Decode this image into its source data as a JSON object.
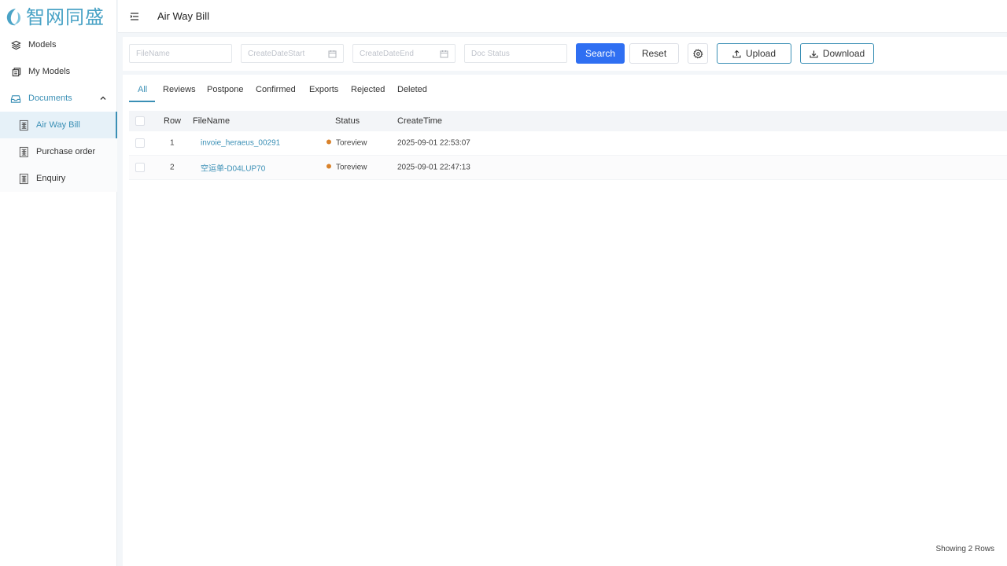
{
  "app": {
    "logo_text": "智网同盛"
  },
  "sidebar": {
    "items": [
      {
        "label": "Models",
        "icon": "layers-icon"
      },
      {
        "label": "My Models",
        "icon": "stack-icon"
      },
      {
        "label": "Documents",
        "icon": "inbox-icon",
        "expanded": true
      }
    ],
    "sub_items": [
      {
        "label": "Air Way Bill",
        "icon": "document-grid-icon",
        "active": true
      },
      {
        "label": "Purchase order",
        "icon": "document-grid-icon"
      },
      {
        "label": "Enquiry",
        "icon": "document-grid-icon"
      }
    ]
  },
  "header": {
    "title": "Air Way Bill"
  },
  "filters": {
    "file_name_placeholder": "FileName",
    "create_start_placeholder": "CreateDateStart",
    "create_end_placeholder": "CreateDateEnd",
    "doc_status_placeholder": "Doc Status",
    "search_label": "Search",
    "reset_label": "Reset",
    "upload_label": "Upload",
    "download_label": "Download"
  },
  "tabs": [
    "All",
    "Reviews",
    "Postpone",
    "Confirmed",
    "Exports",
    "Rejected",
    "Deleted"
  ],
  "active_tab": "All",
  "table": {
    "columns": [
      "Row",
      "FileName",
      "Status",
      "CreateTime"
    ],
    "rows": [
      {
        "row": "1",
        "file_name": "invoie_heraeus_00291",
        "status": "Toreview",
        "create_time": "2025-09-01 22:53:07"
      },
      {
        "row": "2",
        "file_name": "空运单-D04LUP70",
        "status": "Toreview",
        "create_time": "2025-09-01 22:47:13"
      }
    ]
  },
  "footer": {
    "rows_info": "Showing 2 Rows"
  },
  "colors": {
    "accent": "#3a8fb5",
    "primary_button": "#2f6ff2",
    "status_toreview": "#d9822b",
    "logo": "#4aa3c6"
  }
}
